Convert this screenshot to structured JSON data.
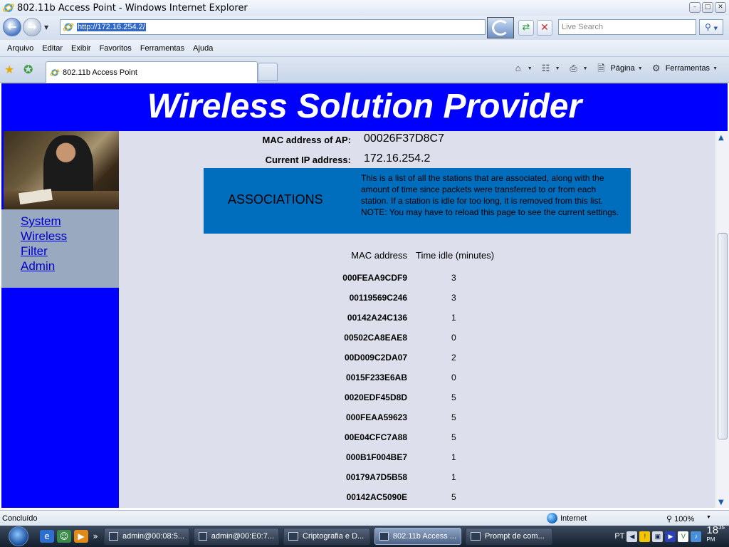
{
  "window": {
    "title": "802.11b Access Point - Windows Internet Explorer",
    "minimize": "–",
    "maximize": "□",
    "close": "✕"
  },
  "address_bar": {
    "url": "http://172.16.254.2/",
    "search_placeholder": "Live Search"
  },
  "menu": [
    "Arquivo",
    "Editar",
    "Exibir",
    "Favoritos",
    "Ferramentas",
    "Ajuda"
  ],
  "tabs": [
    {
      "label": "802.11b Access Point",
      "active": true
    }
  ],
  "command_bar": {
    "page_label": "Página",
    "tools_label": "Ferramentas"
  },
  "page": {
    "banner": "Wireless Solution Provider",
    "nav": [
      "System",
      "Wireless",
      "Filter",
      "Admin"
    ],
    "mac_label": "MAC address of AP:",
    "mac_value": "00026F37D8C7",
    "ip_label": "Current IP address:",
    "ip_value": "172.16.254.2",
    "assoc_title": "ASSOCIATIONS",
    "assoc_desc": "This is a list of all the stations that are associated, along with the amount of time since packets were transferred to or from each station. If a station is idle for too long, it is removed from this list. NOTE: You may have to reload this page to see the current settings.",
    "table": {
      "headers": [
        "MAC address",
        "Time idle (minutes)"
      ],
      "rows": [
        {
          "mac": "000FEAA9CDF9",
          "idle": "3"
        },
        {
          "mac": "00119569C246",
          "idle": "3"
        },
        {
          "mac": "00142A24C136",
          "idle": "1"
        },
        {
          "mac": "00502CA8EAE8",
          "idle": "0"
        },
        {
          "mac": "00D009C2DA07",
          "idle": "2"
        },
        {
          "mac": "0015F233E6AB",
          "idle": "0"
        },
        {
          "mac": "0020EDF45D8D",
          "idle": "5"
        },
        {
          "mac": "000FEAA59623",
          "idle": "5"
        },
        {
          "mac": "00E04CFC7A88",
          "idle": "5"
        },
        {
          "mac": "000B1F004BE7",
          "idle": "1"
        },
        {
          "mac": "00179A7D5B58",
          "idle": "1"
        },
        {
          "mac": "00142AC5090E",
          "idle": "5"
        }
      ]
    }
  },
  "status_bar": {
    "status": "Concluído",
    "zone": "Internet",
    "zoom": "100%"
  },
  "taskbar": {
    "tasks": [
      {
        "label": "admin@00:08:5...",
        "active": false
      },
      {
        "label": "admin@00:E0:7...",
        "active": false
      },
      {
        "label": "Criptografia e D...",
        "active": false
      },
      {
        "label": "802.11b Access ...",
        "active": true
      },
      {
        "label": "Prompt de com...",
        "active": false
      }
    ],
    "language": "PT",
    "clock_hour": "18",
    "clock_min": "35",
    "clock_ampm": "PM"
  },
  "colors": {
    "banner_bg": "#0000ff",
    "content_bg": "#dde0ec",
    "assoc_bg": "#006dbd",
    "nav_panel_bg": "#99a9bf",
    "link": "#0000cc"
  }
}
